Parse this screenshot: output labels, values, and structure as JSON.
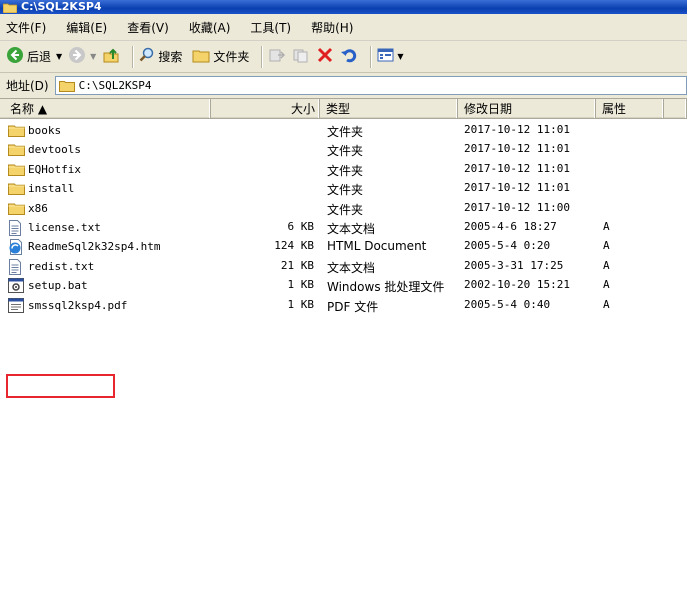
{
  "window": {
    "title": "C:\\SQL2KSP4"
  },
  "menu": [
    "文件(F)",
    "编辑(E)",
    "查看(V)",
    "收藏(A)",
    "工具(T)",
    "帮助(H)"
  ],
  "toolbar": {
    "back_label": "后退",
    "search_label": "搜索",
    "folders_label": "文件夹"
  },
  "address": {
    "label": "地址(D)",
    "value": "C:\\SQL2KSP4"
  },
  "columns": {
    "name": "名称 ▲",
    "size": "大小",
    "type": "类型",
    "modified": "修改日期",
    "attributes": "属性"
  },
  "files": [
    {
      "name": "books",
      "size": "",
      "type": "文件夹",
      "modified": "2017-10-12 11:01",
      "attr": "",
      "icon": "folder-icon"
    },
    {
      "name": "devtools",
      "size": "",
      "type": "文件夹",
      "modified": "2017-10-12 11:01",
      "attr": "",
      "icon": "folder-icon"
    },
    {
      "name": "EQHotfix",
      "size": "",
      "type": "文件夹",
      "modified": "2017-10-12 11:01",
      "attr": "",
      "icon": "folder-icon"
    },
    {
      "name": "install",
      "size": "",
      "type": "文件夹",
      "modified": "2017-10-12 11:01",
      "attr": "",
      "icon": "folder-icon"
    },
    {
      "name": "x86",
      "size": "",
      "type": "文件夹",
      "modified": "2017-10-12 11:00",
      "attr": "",
      "icon": "folder-icon"
    },
    {
      "name": "license.txt",
      "size": "6 KB",
      "type": "文本文档",
      "modified": "2005-4-6 18:27",
      "attr": "A",
      "icon": "text-file-icon"
    },
    {
      "name": "ReadmeSql2k32sp4.htm",
      "size": "124 KB",
      "type": "HTML Document",
      "modified": "2005-5-4 0:20",
      "attr": "A",
      "icon": "html-file-icon"
    },
    {
      "name": "redist.txt",
      "size": "21 KB",
      "type": "文本文档",
      "modified": "2005-3-31 17:25",
      "attr": "A",
      "icon": "text-file-icon"
    },
    {
      "name": "setup.bat",
      "size": "1 KB",
      "type": "Windows 批处理文件",
      "modified": "2002-10-20 15:21",
      "attr": "A",
      "icon": "batch-file-icon"
    },
    {
      "name": "smssql2ksp4.pdf",
      "size": "1 KB",
      "type": "PDF 文件",
      "modified": "2005-5-4 0:40",
      "attr": "A",
      "icon": "pdf-file-icon"
    }
  ],
  "colors": {
    "title_bar": "#0a3fb0",
    "highlight_box": "#e8262e",
    "folder": "#f5d36b"
  }
}
